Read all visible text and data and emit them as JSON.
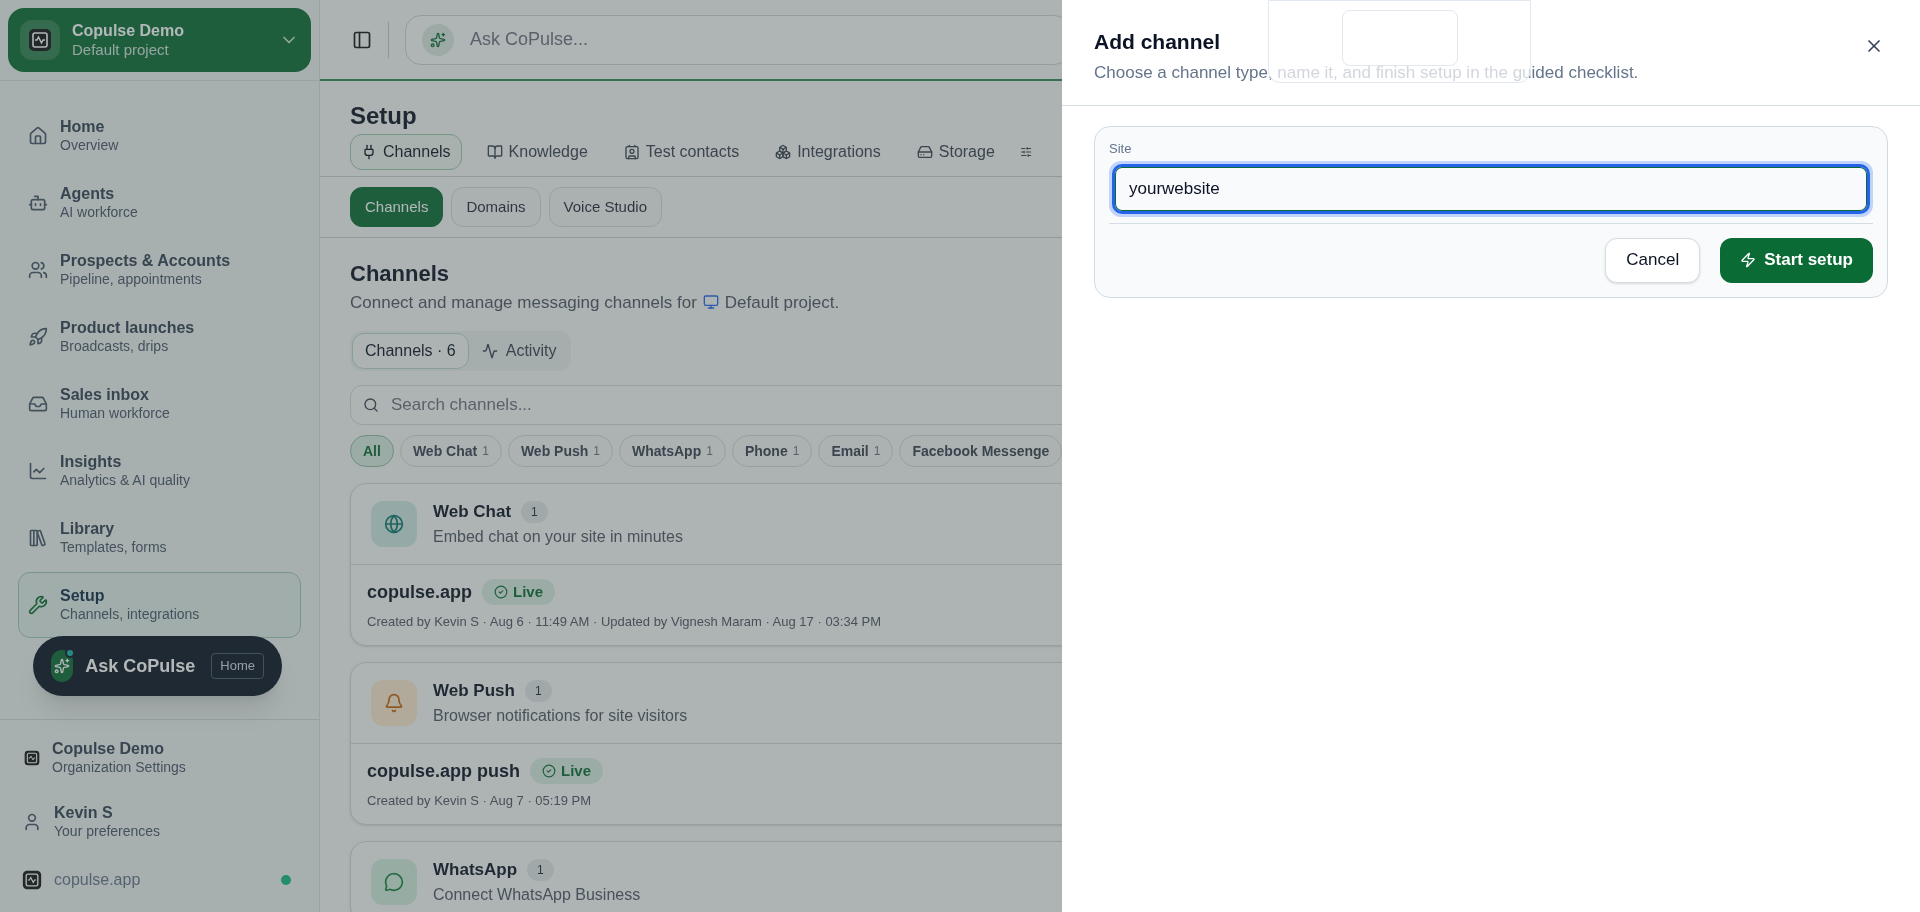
{
  "workspace": {
    "name": "Copulse Demo",
    "project": "Default project"
  },
  "nav": [
    {
      "label": "Home",
      "sub": "Overview",
      "kind": "home",
      "selected": false
    },
    {
      "label": "Agents",
      "sub": "AI workforce",
      "kind": "bot",
      "selected": false
    },
    {
      "label": "Prospects & Accounts",
      "sub": "Pipeline, appointments",
      "kind": "users",
      "selected": false
    },
    {
      "label": "Product launches",
      "sub": "Broadcasts, drips",
      "kind": "rocket",
      "selected": false
    },
    {
      "label": "Sales inbox",
      "sub": "Human workforce",
      "kind": "inbox",
      "selected": false
    },
    {
      "label": "Insights",
      "sub": "Analytics & AI quality",
      "kind": "chart",
      "selected": false
    },
    {
      "label": "Library",
      "sub": "Templates, forms",
      "kind": "library",
      "selected": false
    },
    {
      "label": "Setup",
      "sub": "Channels, integrations",
      "kind": "wrench",
      "selected": true
    }
  ],
  "ask_button": {
    "label": "Ask CoPulse",
    "badge": "Home"
  },
  "footer": {
    "org": {
      "name": "Copulse Demo",
      "sub": "Organization Settings"
    },
    "user": {
      "name": "Kevin S",
      "sub": "Your preferences"
    },
    "site": {
      "label": "copulse.app",
      "online": true
    }
  },
  "top_bar": {
    "ask_placeholder": "Ask CoPulse..."
  },
  "page_title": "Setup",
  "tabs": [
    {
      "label": "Channels",
      "kind": "plug",
      "selected": true
    },
    {
      "label": "Knowledge",
      "kind": "book",
      "selected": false
    },
    {
      "label": "Test contacts",
      "kind": "contact",
      "selected": false
    },
    {
      "label": "Integrations",
      "kind": "boxes",
      "selected": false
    },
    {
      "label": "Storage",
      "kind": "drive",
      "selected": false
    }
  ],
  "sub_tabs": [
    {
      "label": "Channels",
      "selected": true
    },
    {
      "label": "Domains",
      "selected": false
    },
    {
      "label": "Voice Studio",
      "selected": false
    }
  ],
  "section": {
    "title": "Channels",
    "description": "Connect and manage messaging channels for",
    "project": "Default project."
  },
  "view_tabs": [
    {
      "label": "Channels · 6",
      "kind": "plain",
      "selected": true
    },
    {
      "label": "Activity",
      "kind": "activity",
      "selected": false
    }
  ],
  "search": {
    "placeholder": "Search channels..."
  },
  "filters": [
    {
      "label": "All",
      "selected": true
    },
    {
      "label": "Web Chat",
      "count": "1",
      "selected": false
    },
    {
      "label": "Web Push",
      "count": "1",
      "selected": false
    },
    {
      "label": "WhatsApp",
      "count": "1",
      "selected": false
    },
    {
      "label": "Phone",
      "count": "1",
      "selected": false
    },
    {
      "label": "Email",
      "count": "1",
      "selected": false
    },
    {
      "label": "Facebook Messenge",
      "selected": false
    }
  ],
  "channel_groups": [
    {
      "name": "Web Chat",
      "count": "1",
      "description": "Embed chat on your site in minutes",
      "kind": "globe",
      "items": [
        {
          "name": "copulse.app",
          "status": "Live",
          "meta": "Created by Kevin S · Aug 6 · 11:49 AM · Updated by Vignesh Maram · Aug 17 · 03:34 PM"
        }
      ]
    },
    {
      "name": "Web Push",
      "count": "1",
      "description": "Browser notifications for site visitors",
      "kind": "bell",
      "items": [
        {
          "name": "copulse.app push",
          "status": "Live",
          "meta": "Created by Kevin S · Aug 7 · 05:19 PM"
        }
      ]
    },
    {
      "name": "WhatsApp",
      "count": "1",
      "description": "Connect WhatsApp Business",
      "kind": "whatsapp"
    }
  ],
  "drawer": {
    "title": "Add channel",
    "subtitle": "Choose a channel type, name it, and finish setup in the guided checklist.",
    "field": {
      "label": "Site",
      "value": "yourwebsite",
      "focused": true
    },
    "buttons": [
      {
        "label": "Cancel",
        "kind": "secondary"
      },
      {
        "label": "Start setup",
        "kind": "primary"
      }
    ]
  }
}
